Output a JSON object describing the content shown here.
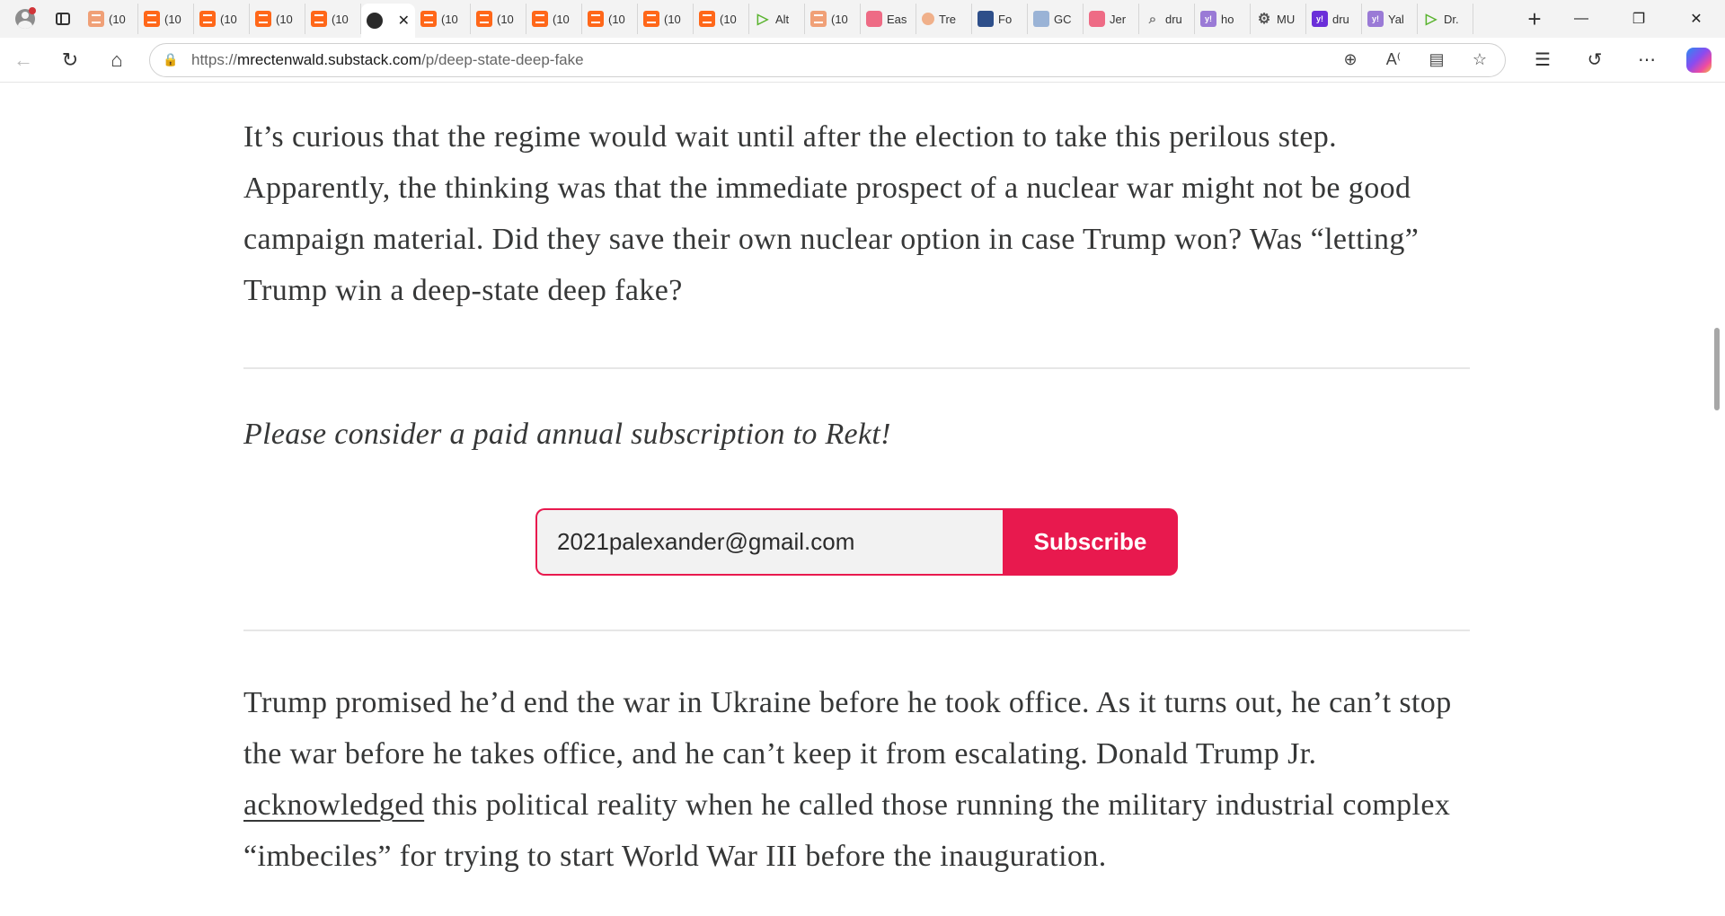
{
  "browser": {
    "tabs": [
      {
        "label": "(10",
        "icon": "substack-faded"
      },
      {
        "label": "(10",
        "icon": "substack"
      },
      {
        "label": "(10",
        "icon": "substack"
      },
      {
        "label": "(10",
        "icon": "substack"
      },
      {
        "label": "(10",
        "icon": "substack"
      },
      {
        "label": "",
        "icon": "avatar",
        "active": true
      },
      {
        "label": "(10",
        "icon": "substack"
      },
      {
        "label": "(10",
        "icon": "substack"
      },
      {
        "label": "(10",
        "icon": "substack"
      },
      {
        "label": "(10",
        "icon": "substack"
      },
      {
        "label": "(10",
        "icon": "substack"
      },
      {
        "label": "(10",
        "icon": "substack"
      },
      {
        "label": "Alt",
        "icon": "play"
      },
      {
        "label": "(10",
        "icon": "substack-faded"
      },
      {
        "label": "Eas",
        "icon": "yt"
      },
      {
        "label": "Tre",
        "icon": "circle"
      },
      {
        "label": "Fo",
        "icon": "fox"
      },
      {
        "label": "GC",
        "icon": "gc"
      },
      {
        "label": "Jer",
        "icon": "yt"
      },
      {
        "label": "dru",
        "icon": "search"
      },
      {
        "label": "ho",
        "icon": "yahoo-faded"
      },
      {
        "label": "MU",
        "icon": "gear"
      },
      {
        "label": "dru",
        "icon": "yahoo"
      },
      {
        "label": "Yal",
        "icon": "yahoo-faded"
      },
      {
        "label": "Dr.",
        "icon": "play"
      }
    ],
    "url_prefix": "https://",
    "url_host": "mrectenwald.substack.com",
    "url_path": "/p/deep-state-deep-fake"
  },
  "article": {
    "paragraph1": "It’s curious that the regime would wait until after the election to take this perilous step. Apparently, the thinking was that the immediate prospect of a nuclear war might not be good campaign material. Did they save their own nuclear option in case Trump won? Was “letting” Trump win a deep-state deep fake?",
    "cta": "Please consider a paid annual subscription to Rekt!",
    "email_value": "2021palexander@gmail.com",
    "subscribe_label": "Subscribe",
    "paragraph2_before": "Trump promised he’d end the war in Ukraine before he took office. As it turns out, he can’t stop the war before he takes office, and he can’t keep it from escalating. Donald Trump Jr. ",
    "paragraph2_link": "acknowledged",
    "paragraph2_after": " this political reality when he called those running the military industrial complex “imbeciles” for trying to start World War III before the inauguration."
  }
}
